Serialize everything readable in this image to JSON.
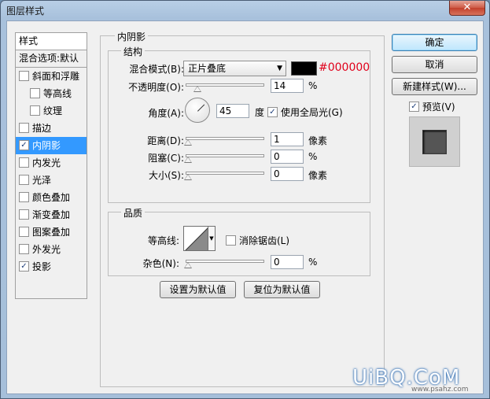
{
  "window": {
    "title": "图层样式",
    "close_glyph": "✕"
  },
  "stylelist": {
    "header": "样式",
    "blend_options": "混合选项:默认",
    "items": [
      {
        "label": "斜面和浮雕",
        "checked": false,
        "sub": false,
        "selected": false
      },
      {
        "label": "等高线",
        "checked": false,
        "sub": true,
        "selected": false
      },
      {
        "label": "纹理",
        "checked": false,
        "sub": true,
        "selected": false
      },
      {
        "label": "描边",
        "checked": false,
        "sub": false,
        "selected": false
      },
      {
        "label": "内阴影",
        "checked": true,
        "sub": false,
        "selected": true
      },
      {
        "label": "内发光",
        "checked": false,
        "sub": false,
        "selected": false
      },
      {
        "label": "光泽",
        "checked": false,
        "sub": false,
        "selected": false
      },
      {
        "label": "颜色叠加",
        "checked": false,
        "sub": false,
        "selected": false
      },
      {
        "label": "渐变叠加",
        "checked": false,
        "sub": false,
        "selected": false
      },
      {
        "label": "图案叠加",
        "checked": false,
        "sub": false,
        "selected": false
      },
      {
        "label": "外发光",
        "checked": false,
        "sub": false,
        "selected": false
      },
      {
        "label": "投影",
        "checked": true,
        "sub": false,
        "selected": false
      }
    ]
  },
  "inner_shadow": {
    "panel_title": "内阴影",
    "structure": {
      "title": "结构",
      "blend_mode_label": "混合模式(B):",
      "blend_mode_value": "正片叠底",
      "color_value": "#000000",
      "color_hex_label": "#000000",
      "opacity_label": "不透明度(O):",
      "opacity_value": "14",
      "opacity_unit": "%",
      "angle_label": "角度(A):",
      "angle_value": "45",
      "angle_unit": "度",
      "global_light_label": "使用全局光(G)",
      "global_light_checked": true,
      "distance_label": "距离(D):",
      "distance_value": "1",
      "distance_unit": "像素",
      "choke_label": "阻塞(C):",
      "choke_value": "0",
      "choke_unit": "%",
      "size_label": "大小(S):",
      "size_value": "0",
      "size_unit": "像素"
    },
    "quality": {
      "title": "品质",
      "contour_label": "等高线:",
      "antialias_label": "消除锯齿(L)",
      "antialias_checked": false,
      "noise_label": "杂色(N):",
      "noise_value": "0",
      "noise_unit": "%"
    },
    "make_default": "设置为默认值",
    "reset_default": "复位为默认值"
  },
  "right": {
    "ok": "确定",
    "cancel": "取消",
    "new_style": "新建样式(W)...",
    "preview_label": "预览(V)",
    "preview_checked": true
  },
  "watermark": {
    "main": "UiBQ.CoM",
    "sub": "www.psahz.com"
  },
  "colors": {
    "selection": "#3399ff",
    "hex_label": "#e0001b",
    "title_bar": "#a8c1dc"
  }
}
